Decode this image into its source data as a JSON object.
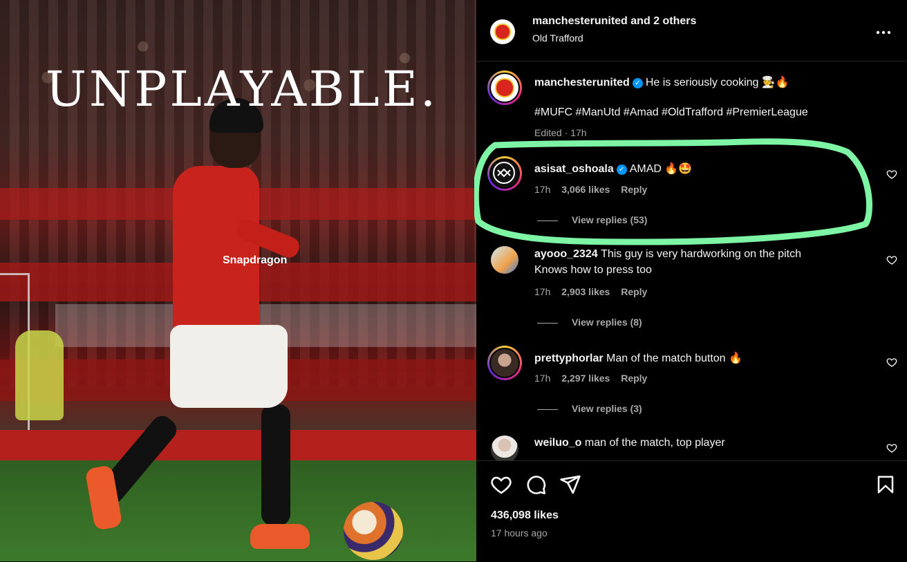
{
  "post": {
    "headline": "UNPLAYABLE.",
    "sponsor": "Snapdragon"
  },
  "header": {
    "owner": "manchesterunited",
    "and_others": "and 2 others",
    "location": "Old Trafford",
    "more_icon": "more-horizontal-icon"
  },
  "caption": {
    "username": "manchesterunited",
    "text": "He is seriously cooking 🧑‍🍳🔥",
    "hashtags": "#MUFC #ManUtd #Amad #OldTrafford #PremierLeague",
    "meta": "Edited · 17h"
  },
  "comments": [
    {
      "username": "asisat_oshoala",
      "verified": true,
      "text": "AMAD 🔥🤩",
      "time": "17h",
      "likes": "3,066 likes",
      "reply": "Reply",
      "view_replies": "View replies (53)"
    },
    {
      "username": "ayooo_2324",
      "verified": false,
      "text": "This guy is very hardworking on the pitch",
      "text2": "Knows how to press too",
      "time": "17h",
      "likes": "2,903 likes",
      "reply": "Reply",
      "view_replies": "View replies (8)"
    },
    {
      "username": "prettyphorlar",
      "verified": false,
      "text": "Man of the match button 🔥",
      "time": "17h",
      "likes": "2,297 likes",
      "reply": "Reply",
      "view_replies": "View replies (3)"
    },
    {
      "username": "weiluo_o",
      "verified": false,
      "text": "man of the match, top player"
    }
  ],
  "footer": {
    "likes": "436,098 likes",
    "time": "17 hours ago"
  },
  "colors": {
    "highlight": "#7df5a4",
    "verified": "#0095f6",
    "muted": "#a8a8a8"
  }
}
